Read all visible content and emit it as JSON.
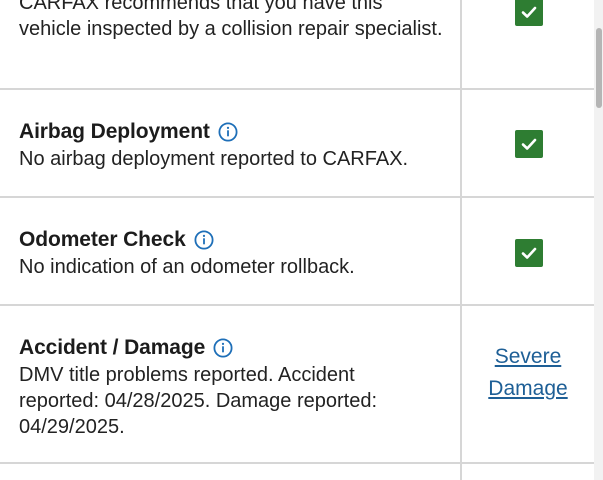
{
  "rows": [
    {
      "description": "CARFAX recommends that you have this vehicle inspected by a collision repair specialist.",
      "status": "check"
    },
    {
      "title": "Airbag Deployment",
      "description": "No airbag deployment reported to CARFAX.",
      "status": "check"
    },
    {
      "title": "Odometer Check",
      "description": "No indication of an odometer rollback.",
      "status": "check"
    },
    {
      "title": "Accident / Damage",
      "description": "DMV title problems reported. Accident reported: 04/28/2025. Damage reported: 04/29/2025.",
      "status": "link",
      "link_label_1": "Severe",
      "link_label_2": "Damage"
    }
  ],
  "colors": {
    "check_green": "#2e7d32",
    "link_blue": "#1e5f96",
    "info_blue": "#1e6fb8",
    "divider": "#d6d6d6"
  },
  "icons": {
    "info": "info-circle-icon",
    "check": "checkmark-icon"
  }
}
